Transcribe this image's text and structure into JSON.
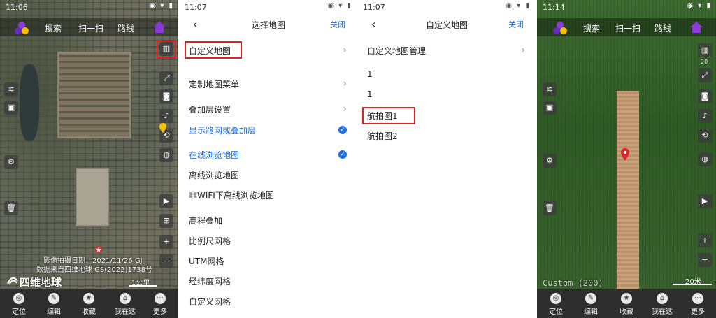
{
  "panel1": {
    "time": "11:06",
    "nav": [
      "搜索",
      "扫一扫",
      "路线"
    ],
    "watermark_lines": [
      "影像拍摄日期：2021/11/26 GJ",
      "数据来自四维地球 GS(2022)1738号"
    ],
    "brand": "四维地球",
    "scale": "1公里",
    "bottom": [
      {
        "label": "定位",
        "icon": "locate-icon"
      },
      {
        "label": "编辑",
        "icon": "edit-icon"
      },
      {
        "label": "收藏",
        "icon": "star-icon"
      },
      {
        "label": "我在这",
        "icon": "pin-icon"
      },
      {
        "label": "更多",
        "icon": "more-icon"
      }
    ]
  },
  "panel2": {
    "time": "11:07",
    "title": "选择地图",
    "close": "关闭",
    "items": [
      {
        "label": "自定义地图"
      },
      {
        "label": "定制地图菜单"
      },
      {
        "label": "叠加层设置"
      },
      {
        "label": "显示路网或叠加层"
      },
      {
        "label": "在线浏览地图"
      },
      {
        "label": "离线浏览地图"
      },
      {
        "label": "非WIFI下离线浏览地图"
      },
      {
        "label": "高程叠加"
      },
      {
        "label": "比例尺网格"
      },
      {
        "label": "UTM网格"
      },
      {
        "label": "经纬度网格"
      },
      {
        "label": "自定义网格"
      }
    ]
  },
  "panel3": {
    "time": "11:07",
    "title": "自定义地图",
    "close": "关闭",
    "items": [
      {
        "label": "自定义地图管理"
      },
      {
        "label": "1"
      },
      {
        "label": "1"
      },
      {
        "label": "航拍图1"
      },
      {
        "label": "航拍图2"
      }
    ]
  },
  "panel4": {
    "time": "11:14",
    "nav": [
      "搜索",
      "扫一扫",
      "路线"
    ],
    "zoom": "20",
    "watermark": "Custom (200)",
    "scale": "20米",
    "bottom": [
      {
        "label": "定位",
        "icon": "locate-icon"
      },
      {
        "label": "编辑",
        "icon": "edit-icon"
      },
      {
        "label": "收藏",
        "icon": "star-icon"
      },
      {
        "label": "我在这",
        "icon": "pin-icon"
      },
      {
        "label": "更多",
        "icon": "more-icon"
      }
    ]
  },
  "colors": {
    "accent": "#1e6fe0",
    "highlight": "#e02020"
  }
}
